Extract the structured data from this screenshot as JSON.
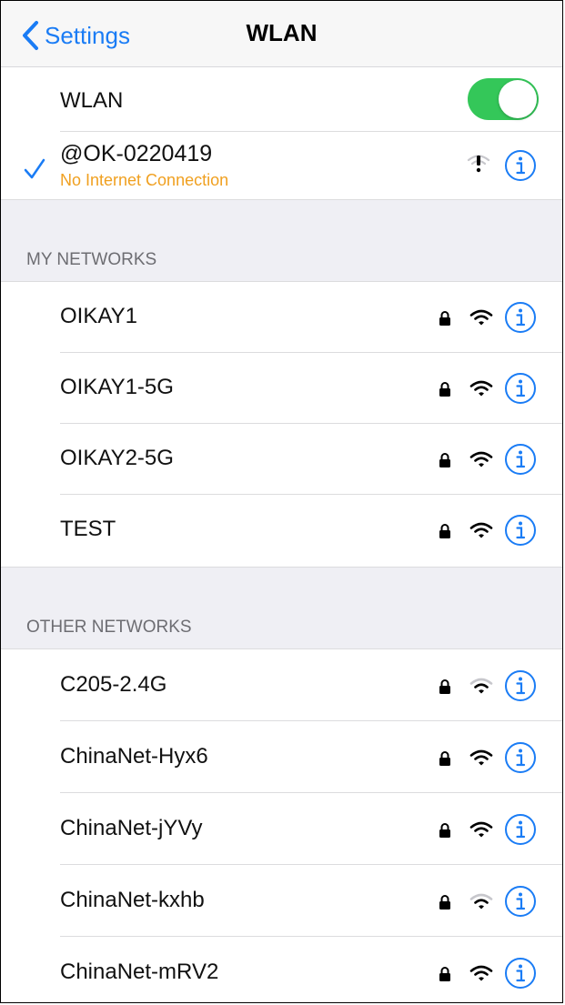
{
  "nav": {
    "back_label": "Settings",
    "title": "WLAN"
  },
  "wlan_toggle": {
    "label": "WLAN",
    "state": "on",
    "color": "#34c759"
  },
  "connected": {
    "name": "@OK-0220419",
    "status": "No Internet Connection",
    "status_color": "#f0a020",
    "icon": "wifi-warning-icon"
  },
  "my_networks": {
    "header": "MY NETWORKS",
    "items": [
      {
        "name": "OIKAY1",
        "secured": true,
        "signal": "full"
      },
      {
        "name": "OIKAY1-5G",
        "secured": true,
        "signal": "full"
      },
      {
        "name": "OIKAY2-5G",
        "secured": true,
        "signal": "full"
      },
      {
        "name": "TEST",
        "secured": true,
        "signal": "full"
      }
    ]
  },
  "other_networks": {
    "header": "OTHER NETWORKS",
    "items": [
      {
        "name": "C205-2.4G",
        "secured": true,
        "signal": "weak"
      },
      {
        "name": "ChinaNet-Hyx6",
        "secured": true,
        "signal": "full"
      },
      {
        "name": "ChinaNet-jYVy",
        "secured": true,
        "signal": "full"
      },
      {
        "name": "ChinaNet-kxhb",
        "secured": true,
        "signal": "weak"
      },
      {
        "name": "ChinaNet-mRV2",
        "secured": true,
        "signal": "full"
      }
    ]
  },
  "accent_color": "#1a7cf5"
}
